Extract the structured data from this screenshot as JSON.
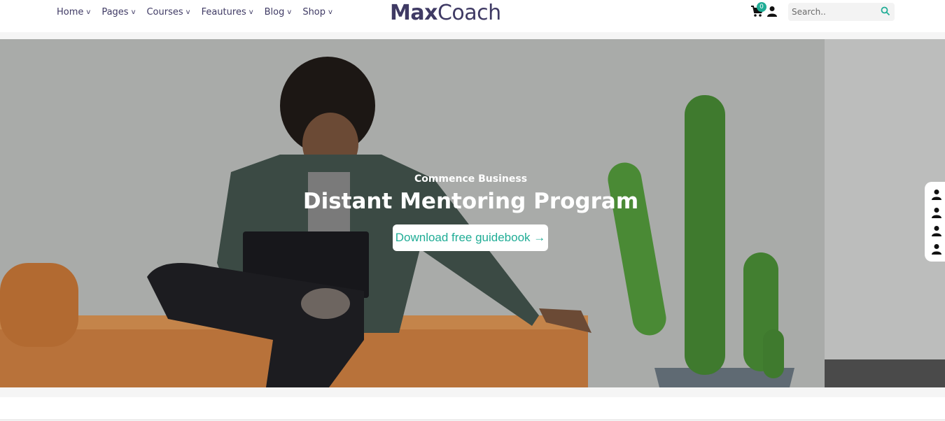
{
  "header": {
    "nav": [
      {
        "label": "Home",
        "chevron": "v"
      },
      {
        "label": "Pages",
        "chevron": "v"
      },
      {
        "label": "Courses",
        "chevron": "v"
      },
      {
        "label": "Feautures",
        "chevron": "v"
      },
      {
        "label": "Blog",
        "chevron": "v"
      },
      {
        "label": "Shop",
        "chevron": "v"
      }
    ],
    "logo": {
      "bold": "Max",
      "regular": "Coach"
    },
    "cart_count": "0",
    "search": {
      "placeholder": "Search..",
      "value": ""
    }
  },
  "hero": {
    "subtitle": "Commence Business",
    "title": "Distant Mentoring Program",
    "button_label": "Download free guidebook →"
  },
  "side_panel": {
    "icons": [
      "user-icon",
      "user-icon",
      "user-icon",
      "user-icon"
    ]
  },
  "colors": {
    "brand": "#3f3a64",
    "accent": "#20ad96"
  }
}
